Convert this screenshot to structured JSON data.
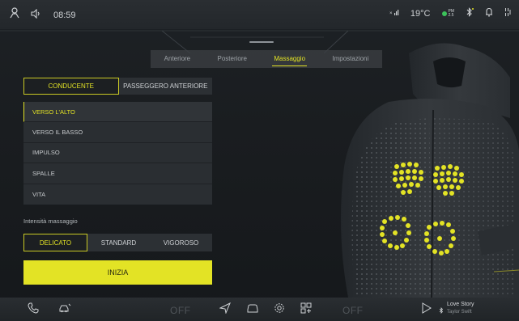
{
  "status_bar": {
    "time": "08:59",
    "temperature": "19°C",
    "aqi_line1": "PM",
    "aqi_line2": "2.5"
  },
  "tabs": [
    {
      "label": "Anteriore",
      "active": false
    },
    {
      "label": "Posteriore",
      "active": false
    },
    {
      "label": "Massaggio",
      "active": true
    },
    {
      "label": "Impostazioni",
      "active": false
    }
  ],
  "seat_selector": {
    "driver": "CONDUCENTE",
    "passenger": "PASSEGGERO ANTERIORE",
    "selected": "CONDUCENTE"
  },
  "massage_zones": [
    {
      "label": "VERSO L'ALTO",
      "active": true
    },
    {
      "label": "VERSO IL BASSO",
      "active": false
    },
    {
      "label": "IMPULSO",
      "active": false
    },
    {
      "label": "SPALLE",
      "active": false
    },
    {
      "label": "VITA",
      "active": false
    }
  ],
  "intensity": {
    "label": "Intensità massaggio",
    "options": [
      "DELICATO",
      "STANDARD",
      "VIGOROSO"
    ],
    "selected": "DELICATO"
  },
  "start_button": "INIZIA",
  "bottom_bar": {
    "left_climate": "OFF",
    "right_climate": "OFF",
    "now_playing_title": "Love Story",
    "now_playing_artist": "Taylor Swift"
  },
  "colors": {
    "accent": "#e3e325",
    "background": "#15181b",
    "panel": "#2a2e32"
  }
}
